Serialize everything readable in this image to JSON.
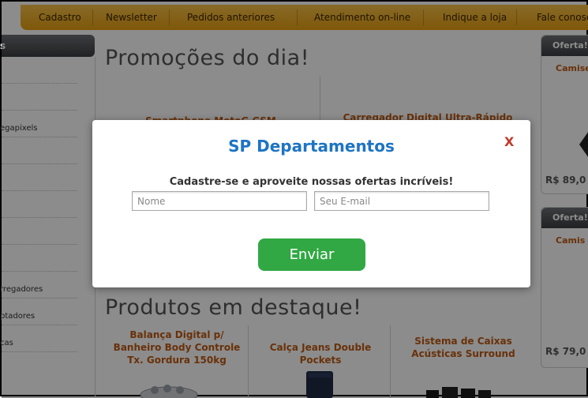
{
  "nav": {
    "items": [
      "Cadastro",
      "Newsletter",
      "Pedidos anteriores",
      "Atendimento on-line",
      "Indique a loja",
      "Fale conosco"
    ]
  },
  "sidebar": {
    "header": "s",
    "items": [
      "",
      "",
      "egapixels",
      "",
      "",
      "",
      "",
      "",
      "rregadores",
      "ptadores",
      "cas"
    ]
  },
  "main": {
    "promo_title": "Promoções do dia!",
    "promo_products": [
      "Smartphone MotoG GSM",
      "Carregador Digital Ultra-Rápido"
    ],
    "featured_title": "Produtos em destaque!",
    "featured_products": [
      "Balança Digital p/ Banheiro Body Controle Tx. Gordura 150kg",
      "Calça Jeans Double Pockets",
      "Sistema de Caixas Acústicas Surround"
    ]
  },
  "right": {
    "offers": [
      {
        "header": "Oferta!",
        "name": "Camise",
        "price": "R$ 89,0"
      },
      {
        "header": "Oferta!",
        "name": "Camis",
        "price": "R$ 79,0"
      }
    ]
  },
  "modal": {
    "title": "SP Departamentos",
    "close": "X",
    "subtitle": "Cadastre-se e aproveite nossas ofertas incríveis!",
    "name_placeholder": "Nome",
    "email_placeholder": "Seu E-mail",
    "submit": "Enviar"
  },
  "colors": {
    "nav_bg": "#e9a51a",
    "accent_orange": "#c05a12",
    "modal_title": "#1d74c4",
    "submit_green": "#31a844",
    "close_red": "#c0392b"
  }
}
